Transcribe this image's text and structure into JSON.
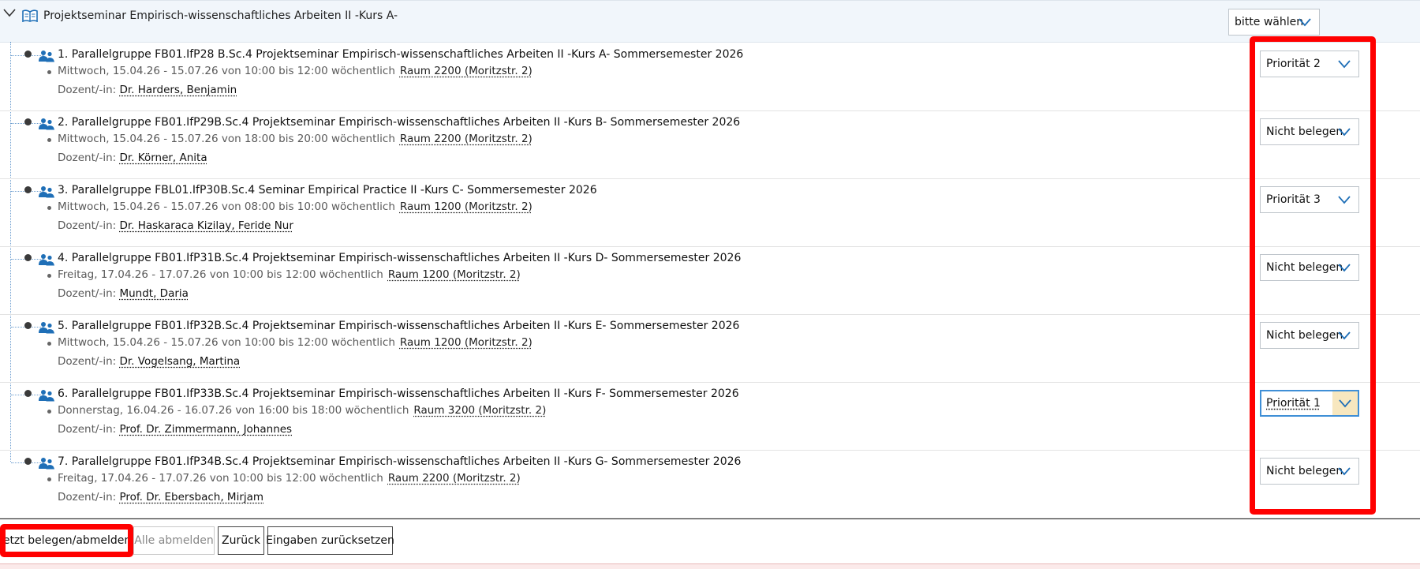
{
  "course": {
    "title": "Projektseminar Empirisch-wissenschaftliches Arbeiten II -Kurs A-",
    "select_value": "bitte wählen"
  },
  "groups": [
    {
      "title": "1. Parallelgruppe FB01.IfP28 B.Sc.4 Projektseminar Empirisch-wissenschaftliches Arbeiten II -Kurs A- Sommersemester 2026",
      "schedule": "Mittwoch, 15.04.26 - 15.07.26 von 10:00 bis 12:00 wöchentlich",
      "room": "Raum 2200 (Moritzstr. 2)",
      "lecturer_label": "Dozent/-in:",
      "lecturer": "Dr. Harders, Benjamin",
      "priority": "Priorität 2"
    },
    {
      "title": "2. Parallelgruppe FB01.IfP29B.Sc.4 Projektseminar Empirisch-wissenschaftliches Arbeiten II -Kurs B- Sommersemester 2026",
      "schedule": "Mittwoch, 15.04.26 - 15.07.26 von 18:00 bis 20:00 wöchentlich",
      "room": "Raum 2200 (Moritzstr. 2)",
      "lecturer_label": "Dozent/-in:",
      "lecturer": "Dr. Körner, Anita",
      "priority": "Nicht belegen"
    },
    {
      "title": "3. Parallelgruppe FBL01.IfP30B.Sc.4 Seminar Empirical Practice II -Kurs C- Sommersemester 2026",
      "schedule": "Mittwoch, 15.04.26 - 15.07.26 von 08:00 bis 10:00 wöchentlich",
      "room": "Raum 1200 (Moritzstr. 2)",
      "lecturer_label": "Dozent/-in:",
      "lecturer": "Dr. Haskaraca Kizilay, Feride Nur",
      "priority": "Priorität 3"
    },
    {
      "title": "4. Parallelgruppe FB01.IfP31B.Sc.4 Projektseminar Empirisch-wissenschaftliches Arbeiten II -Kurs D- Sommersemester 2026",
      "schedule": "Freitag, 17.04.26 - 17.07.26 von 10:00 bis 12:00 wöchentlich",
      "room": "Raum 1200 (Moritzstr. 2)",
      "lecturer_label": "Dozent/-in:",
      "lecturer": "Mundt, Daria",
      "priority": "Nicht belegen"
    },
    {
      "title": "5. Parallelgruppe FB01.IfP32B.Sc.4 Projektseminar Empirisch-wissenschaftliches Arbeiten II -Kurs E- Sommersemester 2026",
      "schedule": "Mittwoch, 15.04.26 - 15.07.26 von 10:00 bis 12:00 wöchentlich",
      "room": "Raum 1200 (Moritzstr. 2)",
      "lecturer_label": "Dozent/-in:",
      "lecturer": "Dr. Vogelsang, Martina",
      "priority": "Nicht belegen"
    },
    {
      "title": "6. Parallelgruppe FB01.IfP33B.Sc.4 Projektseminar Empirisch-wissenschaftliches Arbeiten II -Kurs F- Sommersemester 2026",
      "schedule": "Donnerstag, 16.04.26 - 16.07.26 von 16:00 bis 18:00 wöchentlich",
      "room": "Raum 3200 (Moritzstr. 2)",
      "lecturer_label": "Dozent/-in:",
      "lecturer": "Prof. Dr. Zimmermann, Johannes",
      "priority": "Priorität 1"
    },
    {
      "title": "7. Parallelgruppe FB01.IfP34B.Sc.4 Projektseminar Empirisch-wissenschaftliches Arbeiten II -Kurs G- Sommersemester 2026",
      "schedule": "Freitag, 17.04.26 - 17.07.26 von 10:00 bis 12:00 wöchentlich",
      "room": "Raum 2200 (Moritzstr. 2)",
      "lecturer_label": "Dozent/-in:",
      "lecturer": "Prof. Dr. Ebersbach, Mirjam",
      "priority": "Nicht belegen"
    }
  ],
  "buttons": {
    "submit": "Jetzt belegen/abmelden",
    "unregister_all": "Alle abmelden",
    "back": "Zurück",
    "reset": "Eingaben zurücksetzen"
  },
  "icons": {
    "collapse": "chevron-down-icon",
    "course": "open-book-icon",
    "group": "group-people-icon",
    "dropdown": "chevron-down-icon"
  },
  "colors": {
    "header_bg": "#f1f6fb",
    "accent_blue": "#1f6fb7",
    "annotation_red": "#ff0000",
    "focus_highlight": "#f7e7bf"
  }
}
